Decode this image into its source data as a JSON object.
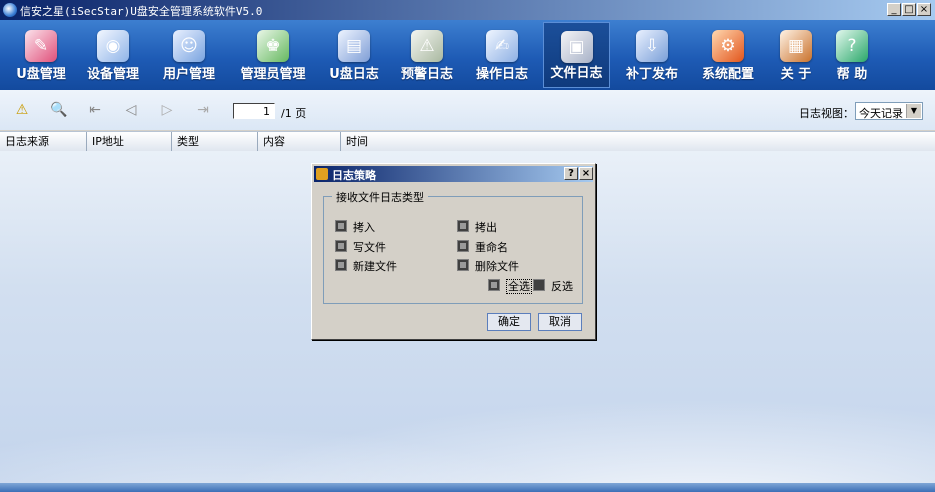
{
  "window": {
    "title": "信安之星(iSecStar)U盘安全管理系统软件V5.0",
    "buttons": {
      "minimize": "_",
      "maximize": "□",
      "close": "×"
    }
  },
  "toolbar": {
    "items": [
      {
        "label": "U盘管理",
        "icon": "usb-management-icon"
      },
      {
        "label": "设备管理",
        "icon": "device-management-icon"
      },
      {
        "label": "用户管理",
        "icon": "user-management-icon"
      },
      {
        "label": "管理员管理",
        "icon": "admin-management-icon"
      },
      {
        "label": "U盘日志",
        "icon": "usb-log-icon"
      },
      {
        "label": "预警日志",
        "icon": "alert-log-icon"
      },
      {
        "label": "操作日志",
        "icon": "operation-log-icon"
      },
      {
        "label": "文件日志",
        "icon": "file-log-icon"
      },
      {
        "label": "补丁发布",
        "icon": "patch-release-icon"
      },
      {
        "label": "系统配置",
        "icon": "system-config-icon"
      },
      {
        "label": "关 于",
        "icon": "about-icon"
      },
      {
        "label": "帮 助",
        "icon": "help-icon"
      }
    ],
    "active": "文件日志"
  },
  "subtoolbar": {
    "page_value": "1",
    "page_total": "/1 页",
    "view_label": "日志视图：",
    "view_value": "今天记录"
  },
  "table": {
    "columns": [
      "日志来源",
      "IP地址",
      "类型",
      "内容",
      "时间"
    ]
  },
  "dialog": {
    "title": "日志策略",
    "help": "?",
    "close": "×",
    "group_label": "接收文件日志类型",
    "options": [
      {
        "label": "拷入",
        "checked": true
      },
      {
        "label": "拷出",
        "checked": true
      },
      {
        "label": "写文件",
        "checked": true
      },
      {
        "label": "重命名",
        "checked": true
      },
      {
        "label": "新建文件",
        "checked": true
      },
      {
        "label": "删除文件",
        "checked": true
      }
    ],
    "select_all": {
      "label": "全选",
      "checked": true
    },
    "invert": {
      "label": "反选",
      "checked": false
    },
    "ok": "确定",
    "cancel": "取消"
  },
  "colors": {
    "toolbar_bg": "#1e5bb5",
    "title_gradient_start": "#0a246a",
    "title_gradient_end": "#a6caf0",
    "dialog_bg": "#d4d0c8"
  }
}
